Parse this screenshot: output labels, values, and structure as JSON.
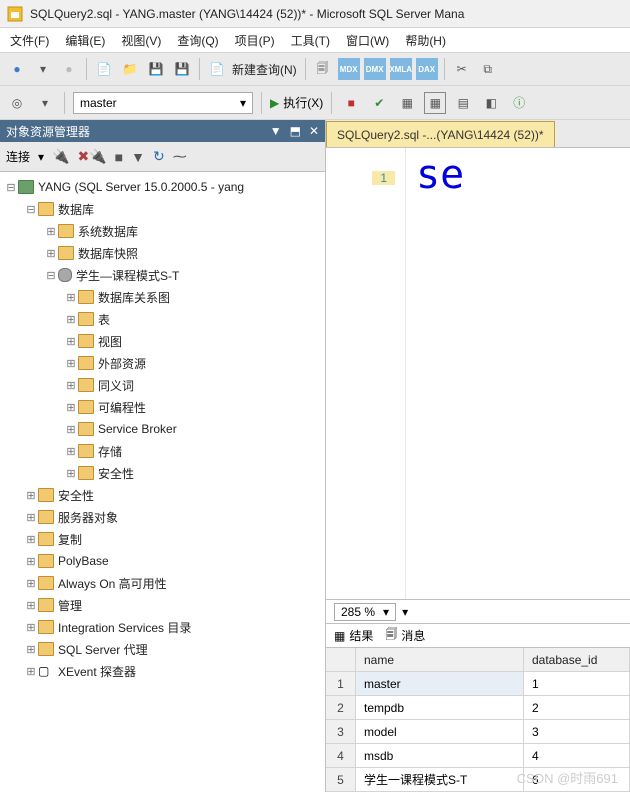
{
  "window": {
    "title": "SQLQuery2.sql - YANG.master (YANG\\14424 (52))* - Microsoft SQL Server Mana"
  },
  "menu": [
    "文件(F)",
    "编辑(E)",
    "视图(V)",
    "查询(Q)",
    "项目(P)",
    "工具(T)",
    "窗口(W)",
    "帮助(H)"
  ],
  "toolbar1": {
    "new_query": "新建查询(N)",
    "badges": [
      "MDX",
      "DMX",
      "XMLA",
      "DAX"
    ]
  },
  "toolbar2": {
    "db_selected": "master",
    "execute": "执行(X)"
  },
  "explorer": {
    "title": "对象资源管理器",
    "connect_label": "连接",
    "root": "YANG (SQL Server 15.0.2000.5 - yang",
    "nodes": {
      "databases": "数据库",
      "sys_db": "系统数据库",
      "db_snapshot": "数据库快照",
      "student_db": "学生—课程模式S-T",
      "db_diagrams": "数据库关系图",
      "tables": "表",
      "views": "视图",
      "ext_resources": "外部资源",
      "synonyms": "同义词",
      "programmability": "可编程性",
      "service_broker": "Service Broker",
      "storage": "存储",
      "security_inner": "安全性",
      "security": "安全性",
      "server_objects": "服务器对象",
      "replication": "复制",
      "polybase": "PolyBase",
      "always_on": "Always On 高可用性",
      "management": "管理",
      "integration": "Integration Services 目录",
      "sql_agent": "SQL Server 代理",
      "xevent": "XEvent 探查器"
    }
  },
  "editor": {
    "tab": "SQLQuery2.sql -...(YANG\\14424 (52))*",
    "line_no": "1",
    "code": "se",
    "zoom": "285 %"
  },
  "results": {
    "tab_results": "结果",
    "tab_messages": "消息",
    "columns": [
      "name",
      "database_id"
    ],
    "rows": [
      {
        "n": "1",
        "name": "master",
        "id": "1"
      },
      {
        "n": "2",
        "name": "tempdb",
        "id": "2"
      },
      {
        "n": "3",
        "name": "model",
        "id": "3"
      },
      {
        "n": "4",
        "name": "msdb",
        "id": "4"
      },
      {
        "n": "5",
        "name": "学生一课程模式S-T",
        "id": "6"
      }
    ]
  },
  "watermark": "CSDN @时雨691"
}
